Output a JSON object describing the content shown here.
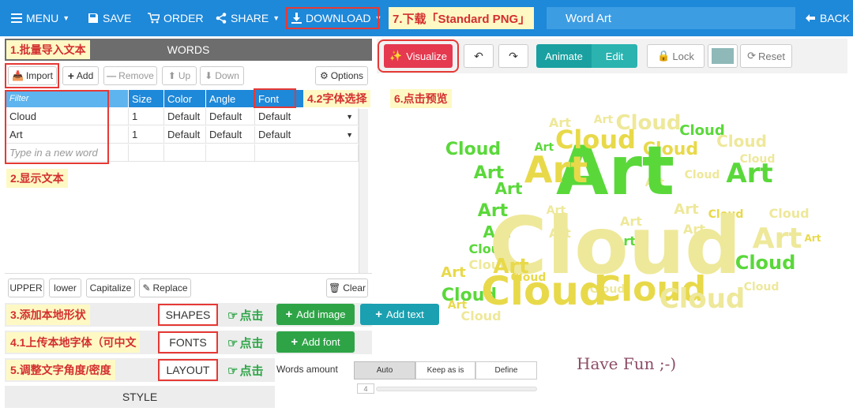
{
  "topbar": {
    "menu": "MENU",
    "save": "SAVE",
    "order": "ORDER",
    "share": "SHARE",
    "download": "DOWNLOAD",
    "title": "Word Art",
    "back": "BACK"
  },
  "annotations": {
    "import_batch": "1.批量导入文本",
    "show_text": "2.显示文本",
    "add_shape": "3.添加本地形状",
    "upload_font": "4.1上传本地字体（可中文",
    "font_select": "4.2字体选择",
    "adjust_layout": "5.调整文字角度/密度",
    "preview": "6.点击预览",
    "download_png": "7.下载「Standard PNG」",
    "click": "点击"
  },
  "words_panel": {
    "header": "WORDS",
    "toolbar": {
      "import": "Import",
      "add": "Add",
      "remove": "Remove",
      "up": "Up",
      "down": "Down",
      "options": "Options"
    },
    "columns": [
      "Filter",
      "Size",
      "Color",
      "Angle",
      "Font"
    ],
    "rows": [
      {
        "word": "Cloud",
        "size": "1",
        "color": "Default",
        "angle": "Default",
        "font": "Default"
      },
      {
        "word": "Art",
        "size": "1",
        "color": "Default",
        "angle": "Default",
        "font": "Default"
      }
    ],
    "new_word_placeholder": "Type in a new word",
    "bottom": {
      "upper": "UPPER",
      "lower": "lower",
      "capitalize": "Capitalize",
      "replace": "Replace",
      "clear": "Clear"
    }
  },
  "sections": {
    "shapes": "SHAPES",
    "fonts": "FONTS",
    "layout": "LAYOUT",
    "style": "STYLE",
    "add_image": "Add image",
    "add_text": "Add text",
    "add_font": "Add font",
    "words_amount": "Words amount",
    "amount_options": [
      "Auto",
      "Keep as is",
      "Define"
    ],
    "amount_selected": "Auto",
    "amount_value": "4"
  },
  "preview_toolbar": {
    "visualize": "Visualize",
    "animate": "Animate",
    "edit": "Edit",
    "lock": "Lock",
    "reset": "Reset",
    "color_swatch": "#8fb8b8"
  },
  "canvas": {
    "signature": "Have Fun ;-)",
    "big_words": [
      "Cloud",
      "Art",
      "Art",
      "Cloud",
      "Cloud",
      "Cloud",
      "Art",
      "Cloud",
      "Art",
      "Cloud",
      "Art"
    ],
    "colors": {
      "green": "#5ad83a",
      "yellow": "#e8d94a",
      "pale_yellow": "#eee89a"
    }
  }
}
